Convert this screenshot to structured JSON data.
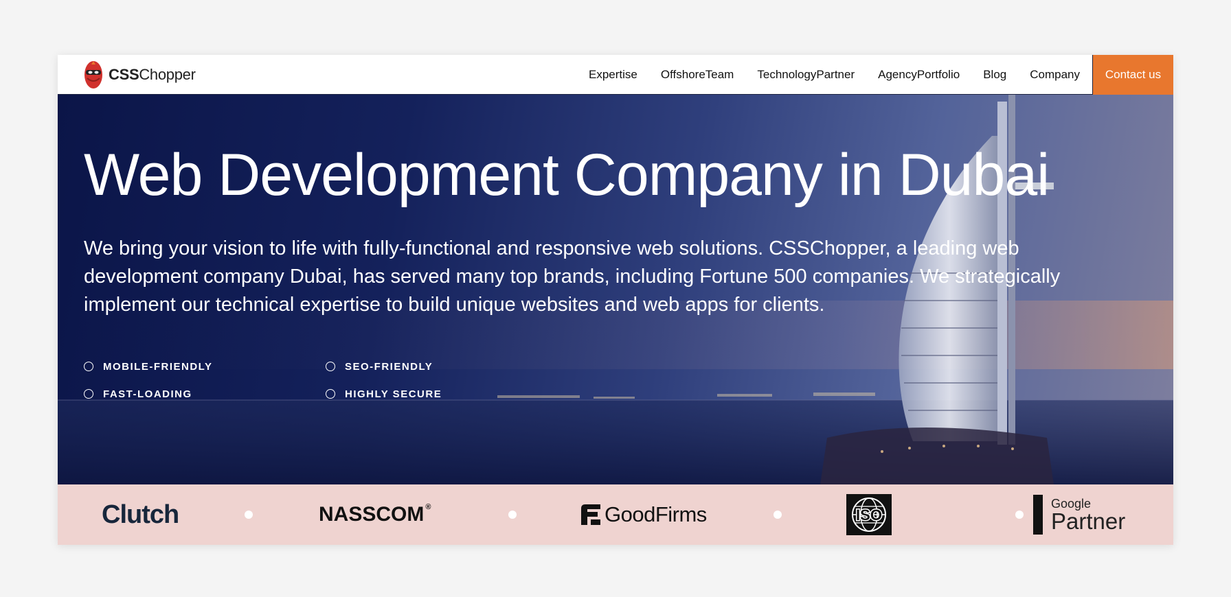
{
  "brand": {
    "name_bold": "CSS",
    "name_rest": "Chopper",
    "accent": "#e8772e",
    "mascot_color": "#d0312d"
  },
  "nav": {
    "items": [
      {
        "label": "Expertise"
      },
      {
        "label": "OffshoreTeam"
      },
      {
        "label": "TechnologyPartner"
      },
      {
        "label": "AgencyPortfolio"
      },
      {
        "label": "Blog"
      },
      {
        "label": "Company"
      }
    ],
    "cta_label": "Contact us"
  },
  "hero": {
    "title": "Web Development Company in Dubai",
    "description": "We bring your vision to life with fully-functional and responsive web solutions. CSSChopper, a leading web development company Dubai, has served many top brands, including Fortune 500 companies. We strategically implement our technical expertise to build unique websites and web apps for clients.",
    "features": [
      {
        "label": "MOBILE-FRIENDLY"
      },
      {
        "label": "SEO-FRIENDLY"
      },
      {
        "label": "FAST-LOADING"
      },
      {
        "label": "HIGHLY SECURE"
      }
    ]
  },
  "partners": {
    "clutch": "Clutch",
    "nasscom": "NASSCOM",
    "nasscom_mark": "®",
    "goodfirms": "GoodFirms",
    "iso": "ISO",
    "google_small": "Google",
    "google_big": "Partner",
    "strip_color": "#efd3d0"
  }
}
